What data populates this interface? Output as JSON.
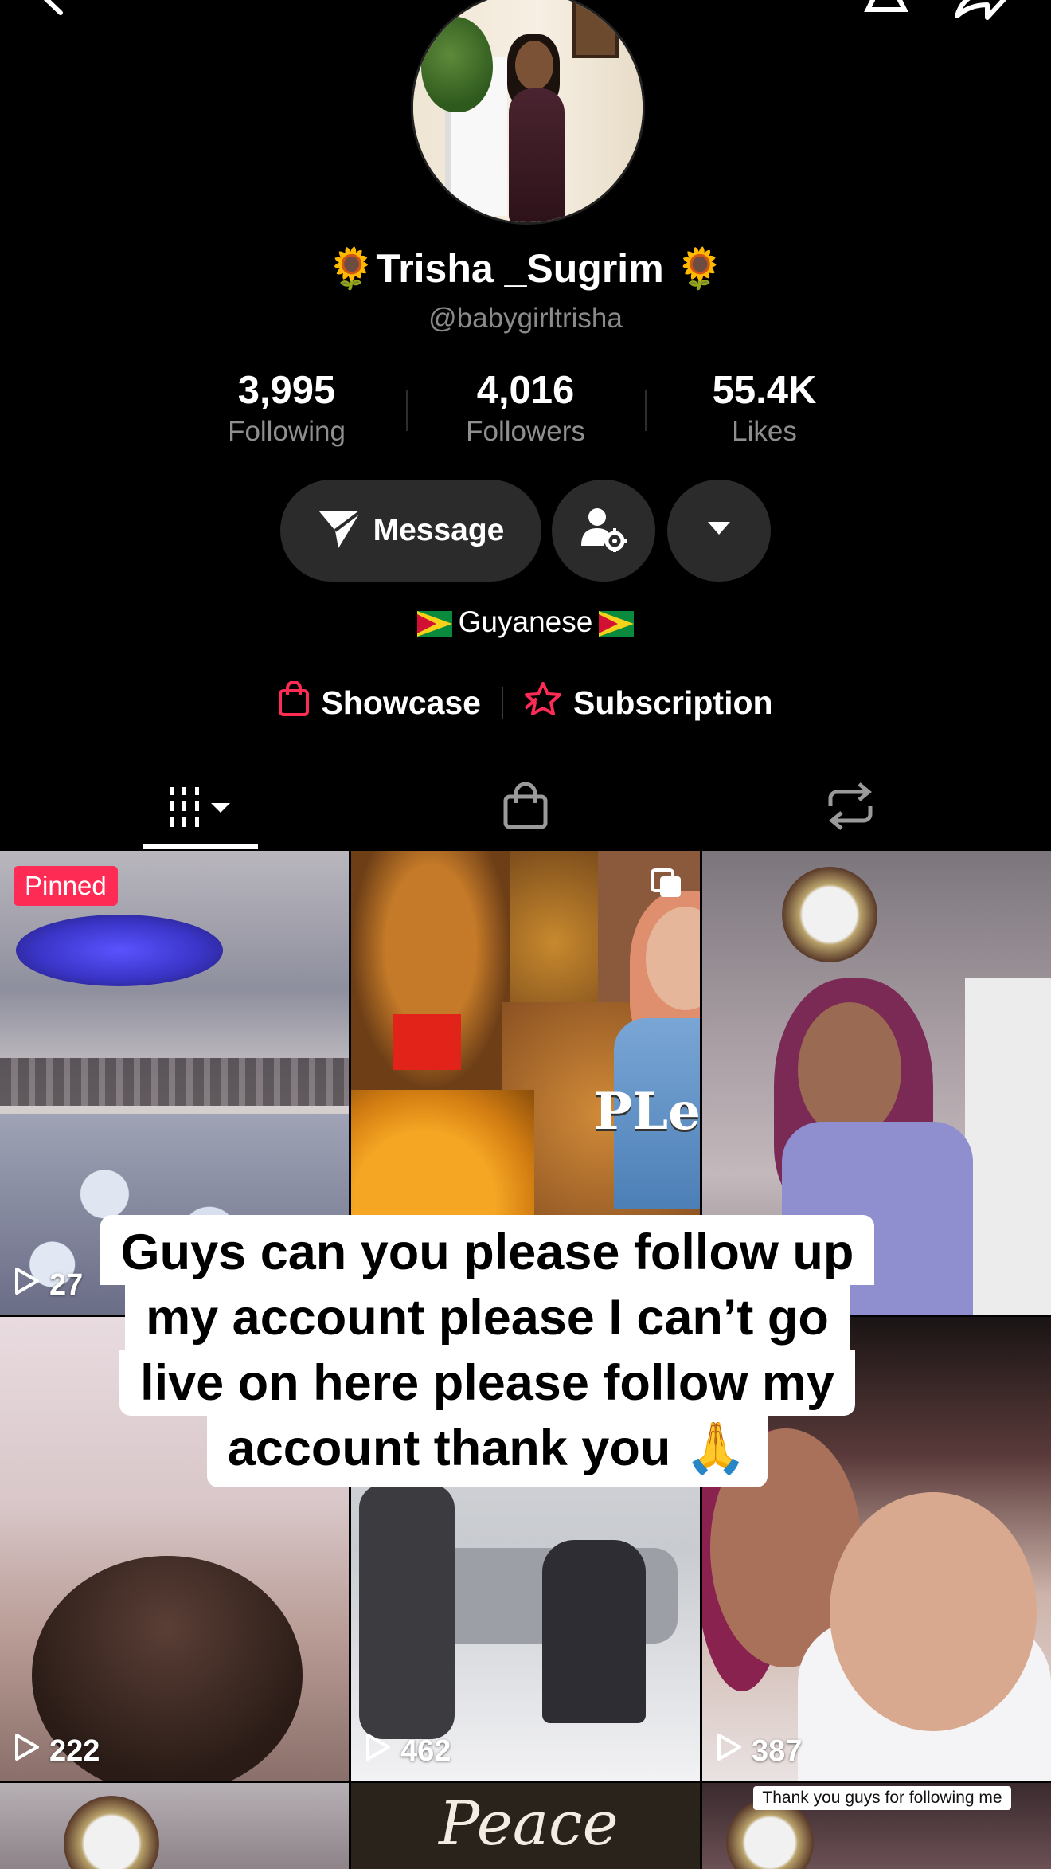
{
  "profile": {
    "display_name": "🌻Trisha _Sugrim 🌻",
    "handle": "@babygirltrisha",
    "stats": [
      {
        "value": "3,995",
        "label": "Following"
      },
      {
        "value": "4,016",
        "label": "Followers"
      },
      {
        "value": "55.4K",
        "label": "Likes"
      }
    ],
    "bio": "Guyanese"
  },
  "actions": {
    "message_label": "Message"
  },
  "links": {
    "showcase": "Showcase",
    "subscription": "Subscription"
  },
  "videos": [
    {
      "badge": "Pinned",
      "views": "27"
    },
    {
      "overlay_text": "PLease"
    },
    {},
    {
      "views": "222"
    },
    {
      "views": "462"
    },
    {
      "views": "387"
    },
    {},
    {
      "overlay_text": "Peace"
    },
    {
      "caption": "Thank you guys for following me"
    }
  ],
  "caption_overlay": {
    "lines": [
      "Guys can you please follow up",
      "my account please I can’t go",
      "live on here please follow my",
      "account thank you 🙏"
    ]
  },
  "colors": {
    "background": "#000000",
    "pinned_badge": "#fe2c55",
    "link_icon": "#fe2c55",
    "button_bg": "#2b2b2b"
  }
}
